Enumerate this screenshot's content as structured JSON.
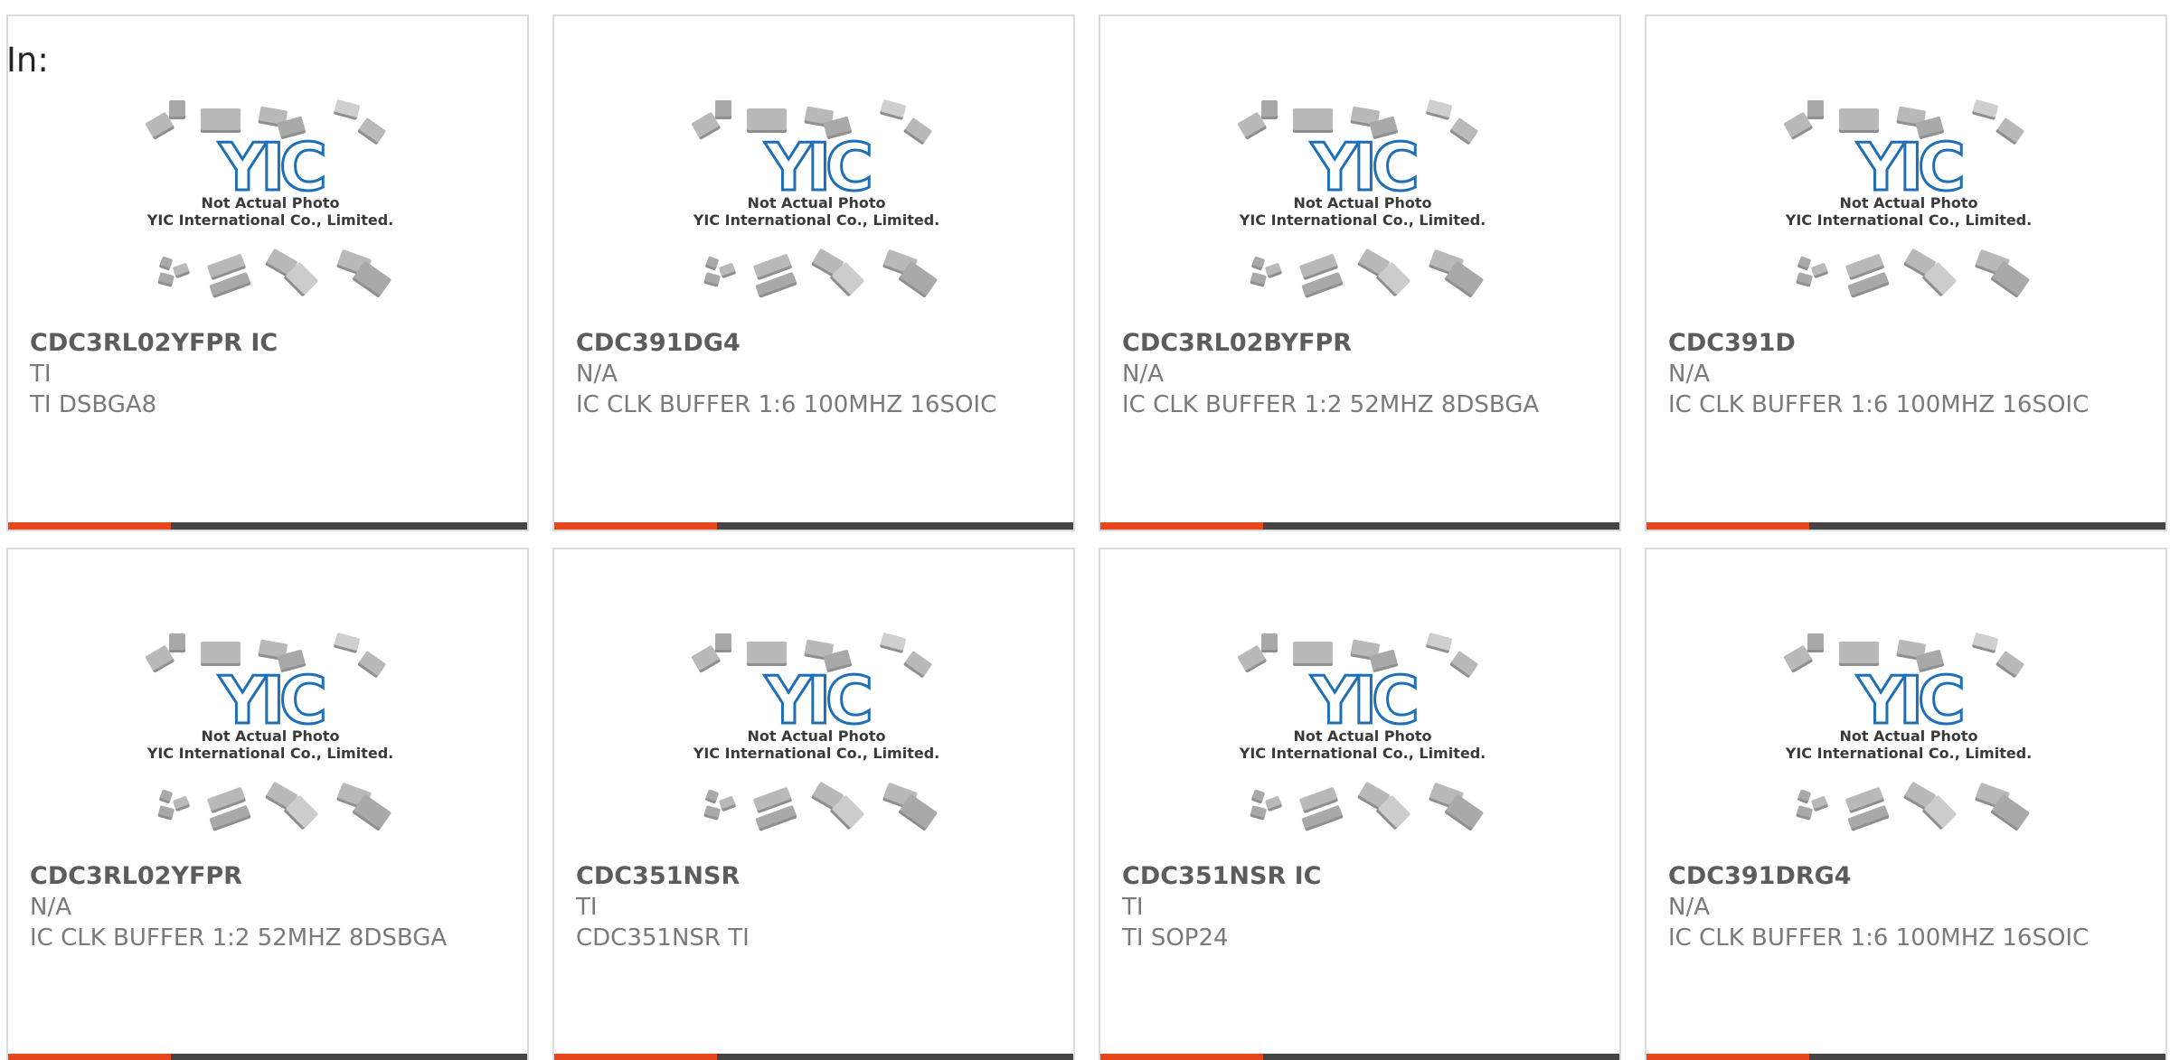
{
  "prefix_label": "In:",
  "colors": {
    "accent": "#e8461c",
    "bar_dark": "#444444",
    "logo_blue": "#1e6fb5",
    "chip_gray": "#b9b9b9"
  },
  "photo": {
    "caption_line_1": "Not Actual Photo",
    "caption_line_2": "YIC International Co., Limited.",
    "logo_text": "YIC"
  },
  "products": [
    {
      "part_number": "CDC3RL02YFPR IC",
      "brand": "TI",
      "description": "TI DSBGA8"
    },
    {
      "part_number": "CDC391DG4",
      "brand": "N/A",
      "description": "IC CLK BUFFER 1:6 100MHZ 16SOIC"
    },
    {
      "part_number": "CDC3RL02BYFPR",
      "brand": "N/A",
      "description": "IC CLK BUFFER 1:2 52MHZ 8DSBGA"
    },
    {
      "part_number": "CDC391D",
      "brand": "N/A",
      "description": "IC CLK BUFFER 1:6 100MHZ 16SOIC"
    },
    {
      "part_number": "CDC3RL02YFPR",
      "brand": "N/A",
      "description": "IC CLK BUFFER 1:2 52MHZ 8DSBGA"
    },
    {
      "part_number": "CDC351NSR",
      "brand": "TI",
      "description": "CDC351NSR TI"
    },
    {
      "part_number": "CDC351NSR IC",
      "brand": "TI",
      "description": "TI SOP24"
    },
    {
      "part_number": "CDC391DRG4",
      "brand": "N/A",
      "description": "IC CLK BUFFER 1:6 100MHZ 16SOIC"
    }
  ]
}
